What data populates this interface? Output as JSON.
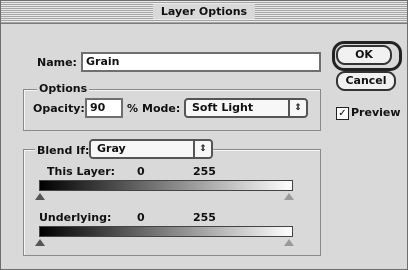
{
  "window": {
    "title": "Layer Options"
  },
  "name_field": {
    "label": "Name:",
    "value": "Grain"
  },
  "options_group": {
    "label": "Options",
    "opacity_label": "Opacity:",
    "opacity_value": "90",
    "percent_sign": "%",
    "mode_label": "Mode:",
    "mode_value": "Soft Light"
  },
  "blend_group": {
    "blend_if_label": "Blend If:",
    "blend_if_value": "Gray",
    "this_layer": {
      "label": "This Layer:",
      "min": "0",
      "max": "255"
    },
    "underlying": {
      "label": "Underlying:",
      "min": "0",
      "max": "255"
    }
  },
  "buttons": {
    "ok": "OK",
    "cancel": "Cancel"
  },
  "preview": {
    "label": "Preview",
    "checked": true,
    "check_glyph": "✓"
  },
  "icons": {
    "popup_arrow": "up-down-arrows-icon"
  }
}
